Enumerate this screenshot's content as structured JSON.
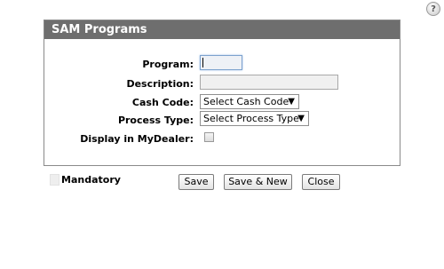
{
  "dialog": {
    "title": "SAM Programs",
    "help_icon": "help-icon"
  },
  "form": {
    "program_label": "Program:",
    "program_value": "",
    "description_label": "Description:",
    "description_value": "",
    "cash_code_label": "Cash Code:",
    "cash_code_selected": "Select Cash Code",
    "process_type_label": "Process Type:",
    "process_type_selected": "Select Process Type",
    "display_label": "Display in MyDealer:",
    "display_checked": false
  },
  "legend": {
    "mandatory_label": "Mandatory"
  },
  "buttons": {
    "save": "Save",
    "save_new": "Save & New",
    "close": "Close"
  }
}
